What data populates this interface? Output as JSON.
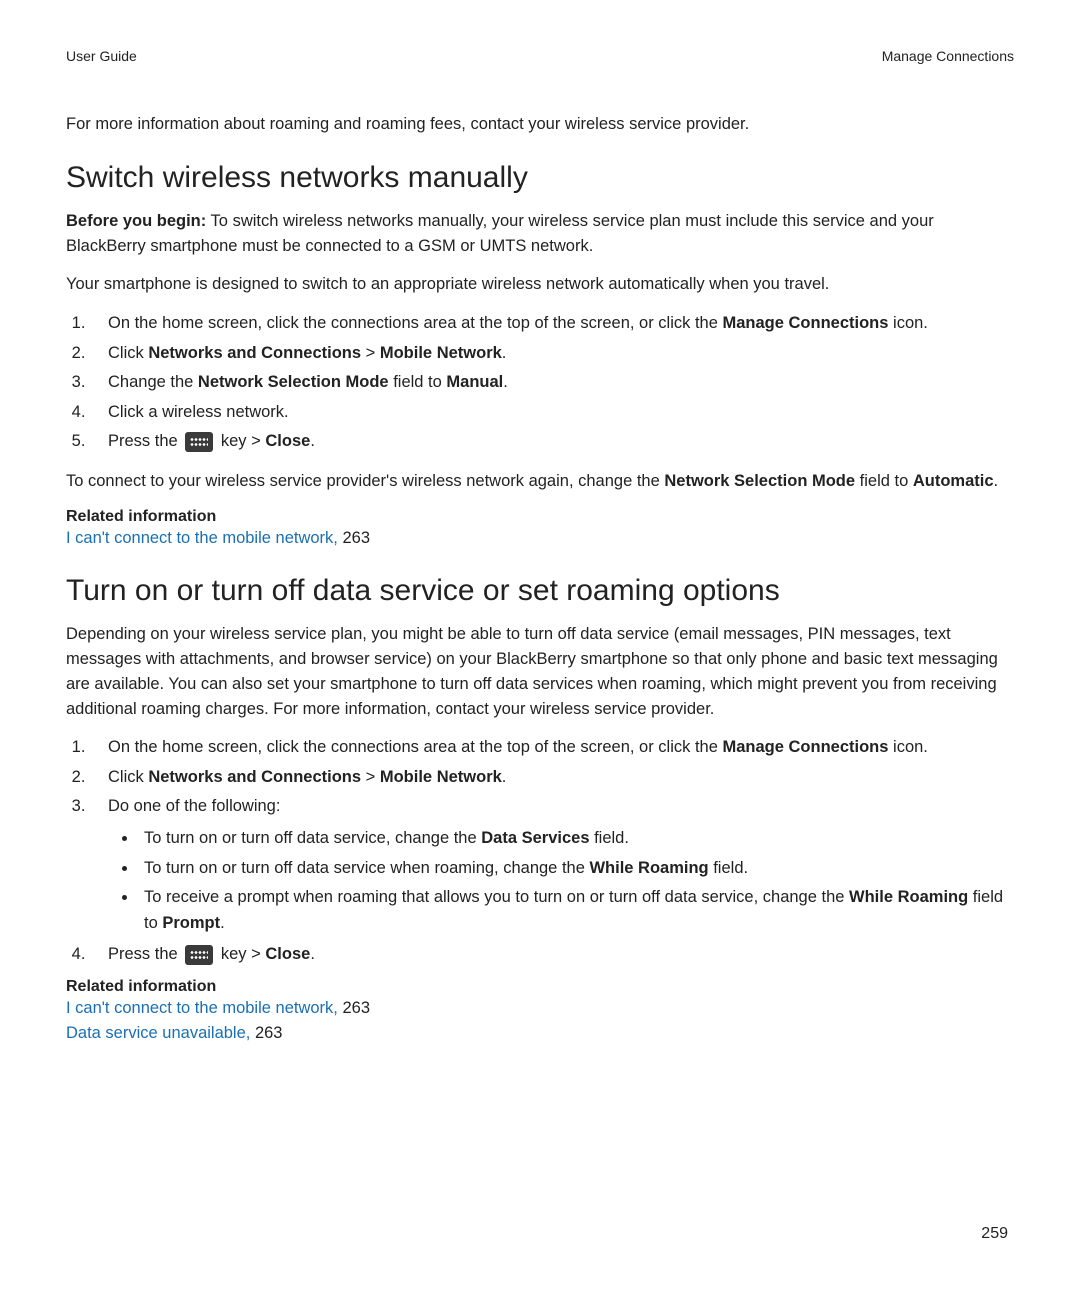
{
  "header": {
    "left": "User Guide",
    "right": "Manage Connections"
  },
  "intro": "For more information about roaming and roaming fees, contact your wireless service provider.",
  "section1": {
    "title": "Switch wireless networks manually",
    "before_label": "Before you begin:",
    "before_text": " To switch wireless networks manually, your wireless service plan must include this service and your BlackBerry smartphone must be connected to a GSM or UMTS network.",
    "para2": "Your smartphone is designed to switch to an appropriate wireless network automatically when you travel.",
    "step1_pre": "On the home screen, click the connections area at the top of the screen, or click the ",
    "step1_bold": "Manage Connections",
    "step1_post": " icon.",
    "step2_pre": "Click ",
    "step2_b1": "Networks and Connections",
    "step2_mid": " > ",
    "step2_b2": "Mobile Network",
    "step2_post": ".",
    "step3_pre": "Change the ",
    "step3_b1": "Network Selection Mode",
    "step3_mid": " field to ",
    "step3_b2": "Manual",
    "step3_post": ".",
    "step4": "Click a wireless network.",
    "step5_pre": "Press the ",
    "step5_mid": " key > ",
    "step5_bold": "Close",
    "step5_post": ".",
    "after_pre": "To connect to your wireless service provider's wireless network again, change the ",
    "after_b1": "Network Selection Mode",
    "after_mid": " field to ",
    "after_b2": "Automatic",
    "after_post": ".",
    "related_title": "Related information",
    "related_link": "I can't connect to the mobile network,",
    "related_page": " 263"
  },
  "section2": {
    "title": "Turn on or turn off data service or set roaming options",
    "para": "Depending on your wireless service plan, you might be able to turn off data service (email messages, PIN messages, text messages with attachments, and browser service) on your BlackBerry smartphone so that only phone and basic text messaging are available. You can also set your smartphone to turn off data services when roaming, which might prevent you from receiving additional roaming charges. For more information, contact your wireless service provider.",
    "step1_pre": "On the home screen, click the connections area at the top of the screen, or click the ",
    "step1_bold": "Manage Connections",
    "step1_post": " icon.",
    "step2_pre": "Click ",
    "step2_b1": "Networks and Connections",
    "step2_mid": " > ",
    "step2_b2": "Mobile Network",
    "step2_post": ".",
    "step3": "Do one of the following:",
    "b1_pre": "To turn on or turn off data service, change the ",
    "b1_bold": "Data Services",
    "b1_post": " field.",
    "b2_pre": "To turn on or turn off data service when roaming, change the ",
    "b2_bold": "While Roaming",
    "b2_post": " field.",
    "b3_pre": "To receive a prompt when roaming that allows you to turn on or turn off data service, change the ",
    "b3_b1": "While Roaming",
    "b3_mid": " field to ",
    "b3_b2": "Prompt",
    "b3_post": ".",
    "step4_pre": "Press the ",
    "step4_mid": " key > ",
    "step4_bold": "Close",
    "step4_post": ".",
    "related_title": "Related information",
    "r1_link": "I can't connect to the mobile network,",
    "r1_page": " 263",
    "r2_link": "Data service unavailable,",
    "r2_page": " 263"
  },
  "page_number": "259"
}
